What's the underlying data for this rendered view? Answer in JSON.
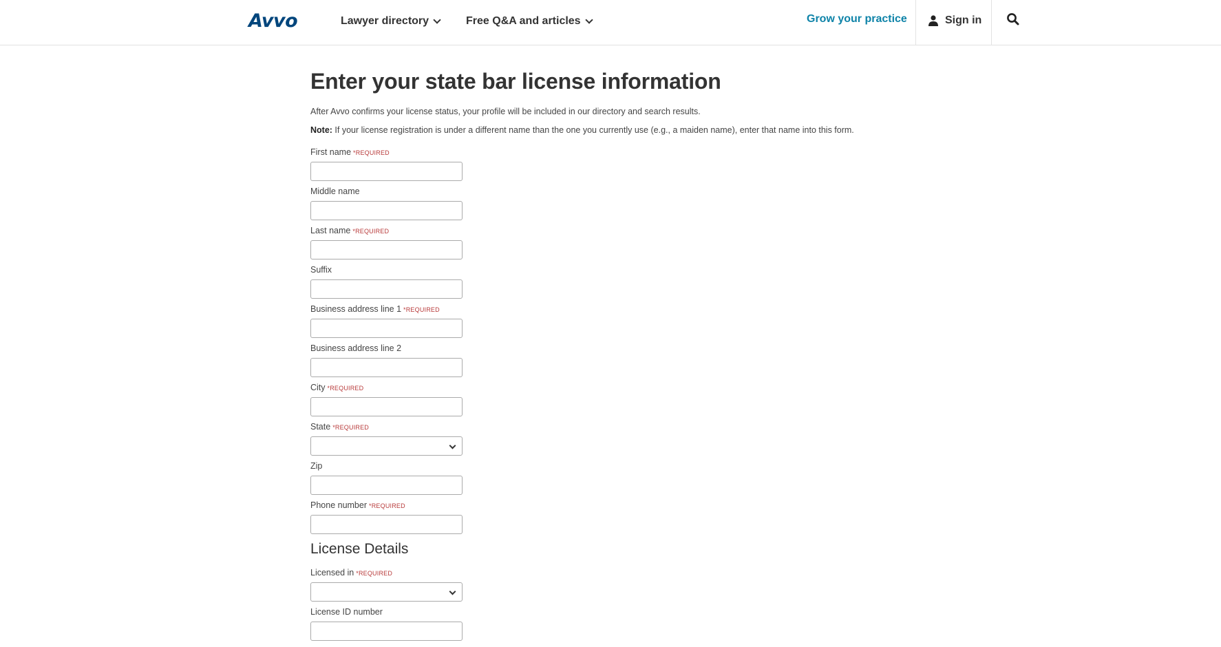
{
  "header": {
    "logo": "Avvo",
    "nav": [
      {
        "label": "Lawyer directory"
      },
      {
        "label": "Free Q&A and articles"
      }
    ],
    "grow_label": "Grow your practice",
    "signin_label": "Sign in"
  },
  "main": {
    "title": "Enter your state bar license information",
    "intro": "After Avvo confirms your license status, your profile will be included in our directory and search results.",
    "note_label": "Note:",
    "note_text": " If your license registration is under a different name than the one you currently use (e.g., a maiden name), enter that name into this form.",
    "required_tag": "*REQUIRED",
    "fields": [
      {
        "label": "First name",
        "value": ""
      },
      {
        "label": "Middle name",
        "value": ""
      },
      {
        "label": "Last name",
        "value": ""
      },
      {
        "label": "Suffix",
        "value": ""
      },
      {
        "label": "Business address line 1",
        "value": ""
      },
      {
        "label": "Business address line 2",
        "value": ""
      },
      {
        "label": "City",
        "value": ""
      },
      {
        "label": "State",
        "value": ""
      },
      {
        "label": "Zip",
        "value": ""
      },
      {
        "label": "Phone number",
        "value": ""
      }
    ],
    "license_heading": "License Details",
    "license_fields": [
      {
        "label": "Licensed in",
        "value": ""
      },
      {
        "label": "License ID number",
        "value": ""
      }
    ]
  },
  "colors": {
    "brand": "#00457c",
    "accent": "#0e83a8",
    "required": "#b83a3a"
  }
}
